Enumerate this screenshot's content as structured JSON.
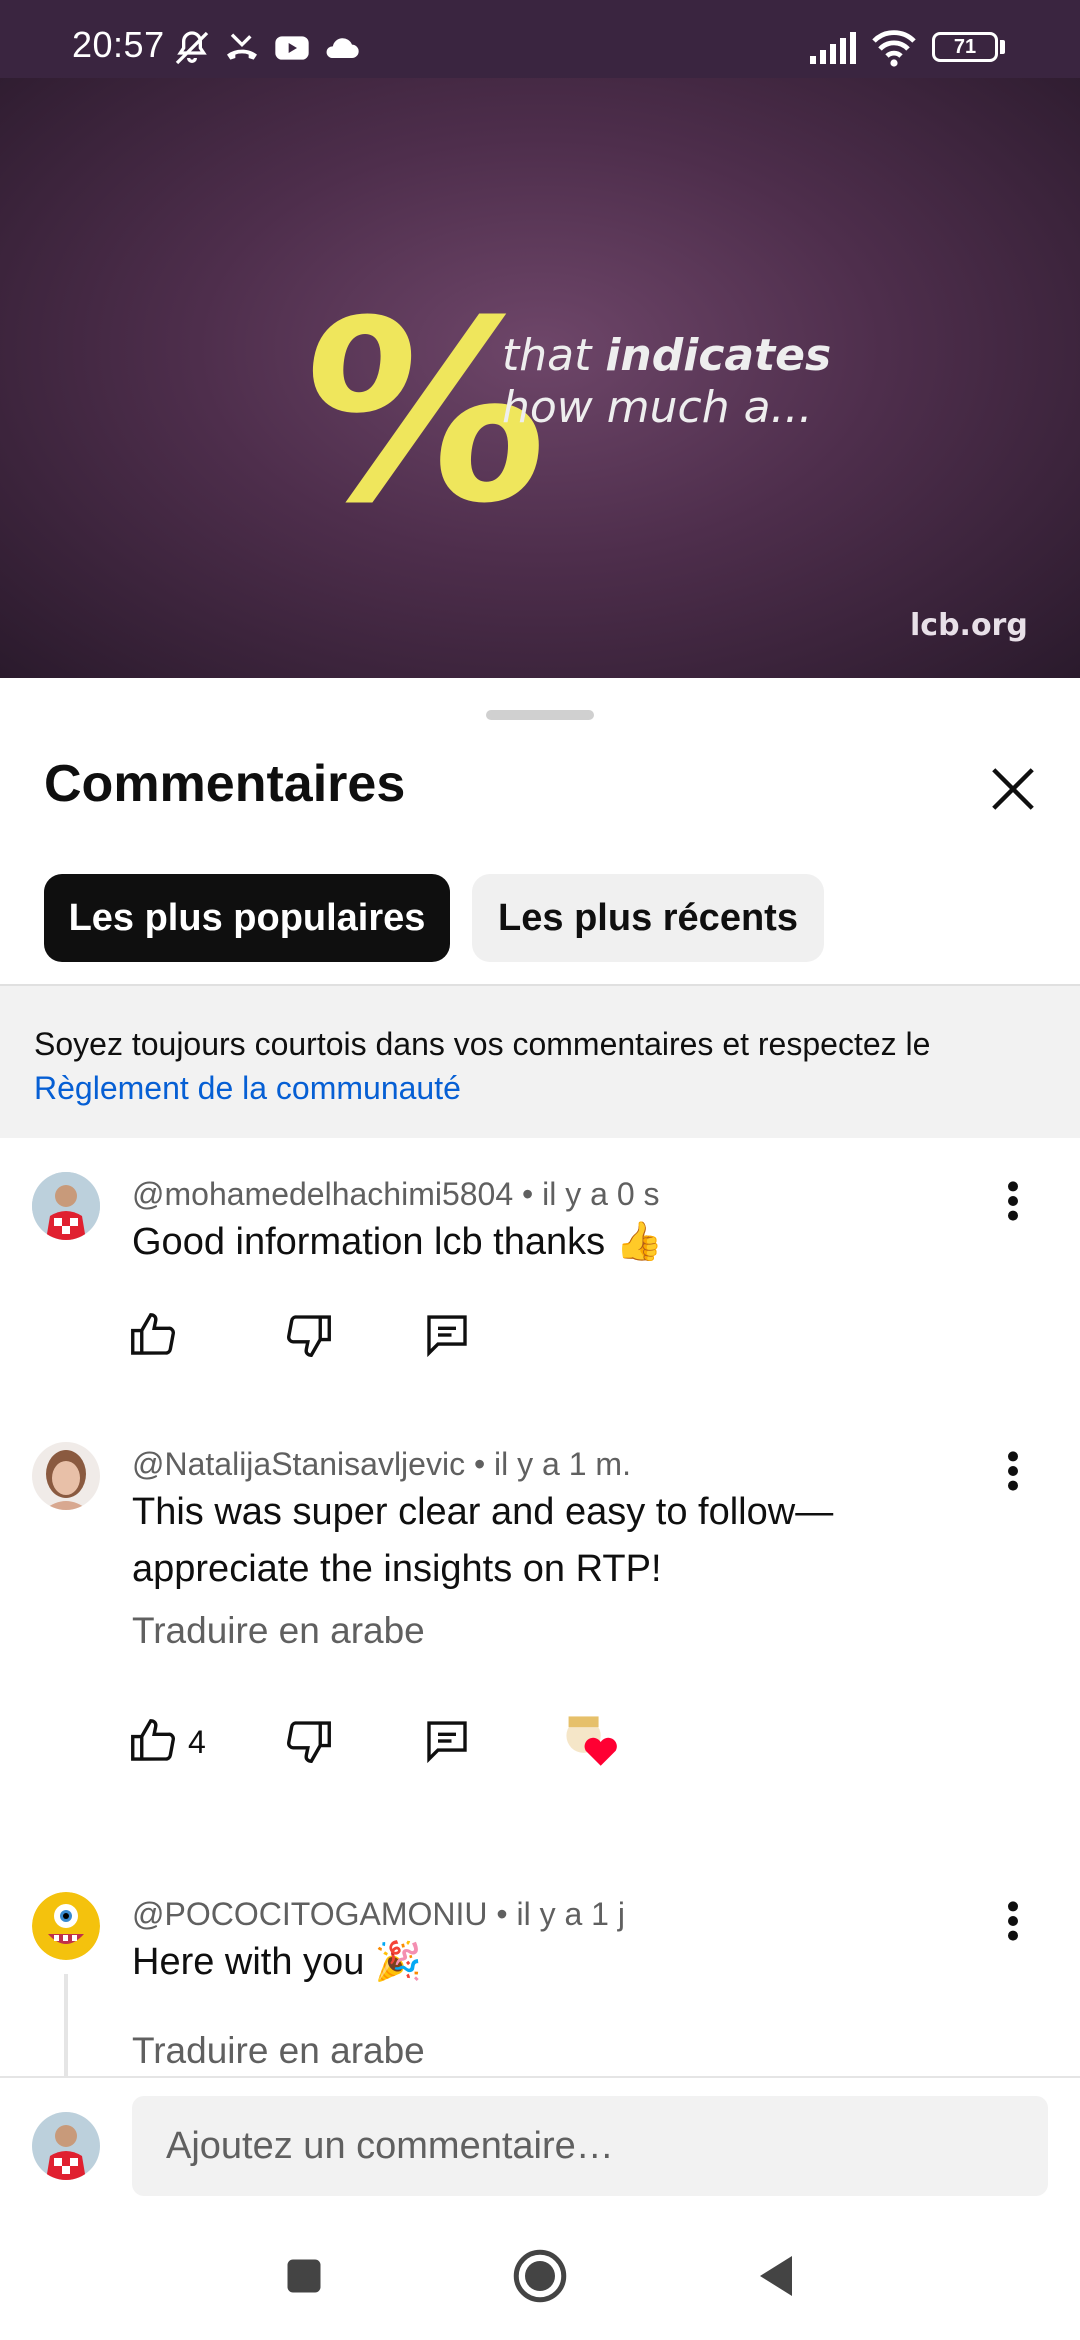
{
  "status_bar": {
    "time": "20:57",
    "battery": "71",
    "icons": [
      "bell-off-icon",
      "missed-call-icon",
      "youtube-icon",
      "cloud-icon",
      "signal-icon",
      "wifi-icon",
      "battery-icon"
    ]
  },
  "video": {
    "symbol": "%",
    "caption_line1_a": "that ",
    "caption_line1_b": "indicates",
    "caption_line2": "how much a...",
    "watermark": "lcb.org",
    "progress_played_fraction": 0.067
  },
  "sheet": {
    "title": "Commentaires",
    "tabs": [
      {
        "label": "Les plus populaires",
        "active": true
      },
      {
        "label": "Les plus récents",
        "active": false
      }
    ],
    "notice_text": "Soyez toujours courtois dans vos commentaires et respectez le",
    "notice_link": "Règlement de la communauté"
  },
  "comments": [
    {
      "author": "@mohamedelhachimi5804",
      "time": "il y a 0 s",
      "text": "Good information lcb thanks 👍",
      "likes": ""
    },
    {
      "author": "@NatalijaStanisavljevic",
      "time": "il y a 1 m.",
      "text": "This was super clear and easy to follow—appreciate the insights on RTP!",
      "translate": "Traduire en arabe",
      "likes": "4"
    },
    {
      "author": "@POCOCITOGAMONIU",
      "time": "il y a 1 j",
      "text": "Here with you 🎉",
      "translate": "Traduire en arabe"
    }
  ],
  "composer": {
    "placeholder": "Ajoutez un commentaire…"
  },
  "colors": {
    "accent_red": "#ff0033",
    "link_blue": "#065fd4",
    "chip_dark": "#0f0f0f",
    "video_text_yellow": "#efe65c"
  }
}
